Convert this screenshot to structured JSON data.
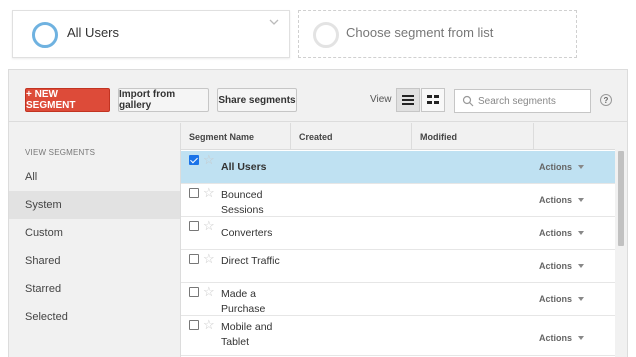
{
  "segments": {
    "active": "All Users",
    "empty": "Choose segment from list"
  },
  "toolbar": {
    "new_segment": "+ NEW SEGMENT",
    "import_gallery": "Import from gallery",
    "share_segments": "Share segments",
    "view_label": "View",
    "search_placeholder": "Search segments",
    "help": "?"
  },
  "sidebar": {
    "heading": "VIEW SEGMENTS",
    "items": [
      {
        "label": "All"
      },
      {
        "label": "System"
      },
      {
        "label": "Custom"
      },
      {
        "label": "Shared"
      },
      {
        "label": "Starred"
      },
      {
        "label": "Selected"
      }
    ]
  },
  "table": {
    "headers": {
      "name": "Segment Name",
      "created": "Created",
      "modified": "Modified",
      "actions": ""
    },
    "rows": [
      {
        "name": "All Users",
        "checked": true,
        "actions": "Actions"
      },
      {
        "name": "Bounced Sessions",
        "checked": false,
        "actions": "Actions"
      },
      {
        "name": "Converters",
        "checked": false,
        "actions": "Actions"
      },
      {
        "name": "Direct Traffic",
        "checked": false,
        "actions": "Actions"
      },
      {
        "name": "Made a Purchase",
        "checked": false,
        "actions": "Actions"
      },
      {
        "name": "Mobile and Tablet",
        "checked": false,
        "actions": "Actions"
      }
    ]
  },
  "colors": {
    "accent_red": "#dd4b39",
    "selected_row": "#bfe1f2",
    "segment_ring": "#6fb2e0"
  }
}
